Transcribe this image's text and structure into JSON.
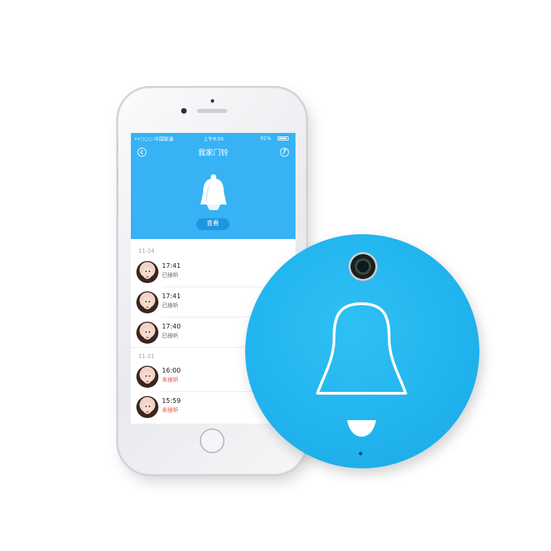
{
  "status_bar": {
    "carrier": "••○○○ 中国联通",
    "time": "上午9:55",
    "battery": "91%"
  },
  "header": {
    "title": "我家门铃"
  },
  "view_button": "查看",
  "groups": [
    {
      "date": "11-24",
      "rows": [
        {
          "time": "17:41",
          "state": "已接听",
          "missed": false
        },
        {
          "time": "17:41",
          "state": "已接听",
          "missed": false
        },
        {
          "time": "17:40",
          "state": "已接听",
          "missed": false
        }
      ]
    },
    {
      "date": "11-21",
      "rows": [
        {
          "time": "16:00",
          "state": "未接听",
          "missed": true
        },
        {
          "time": "15:59",
          "state": "未接听",
          "missed": true
        }
      ]
    }
  ],
  "colors": {
    "app_blue": "#36b2f5",
    "device_blue": "#21b3ee",
    "missed_red": "#f04a3e"
  }
}
